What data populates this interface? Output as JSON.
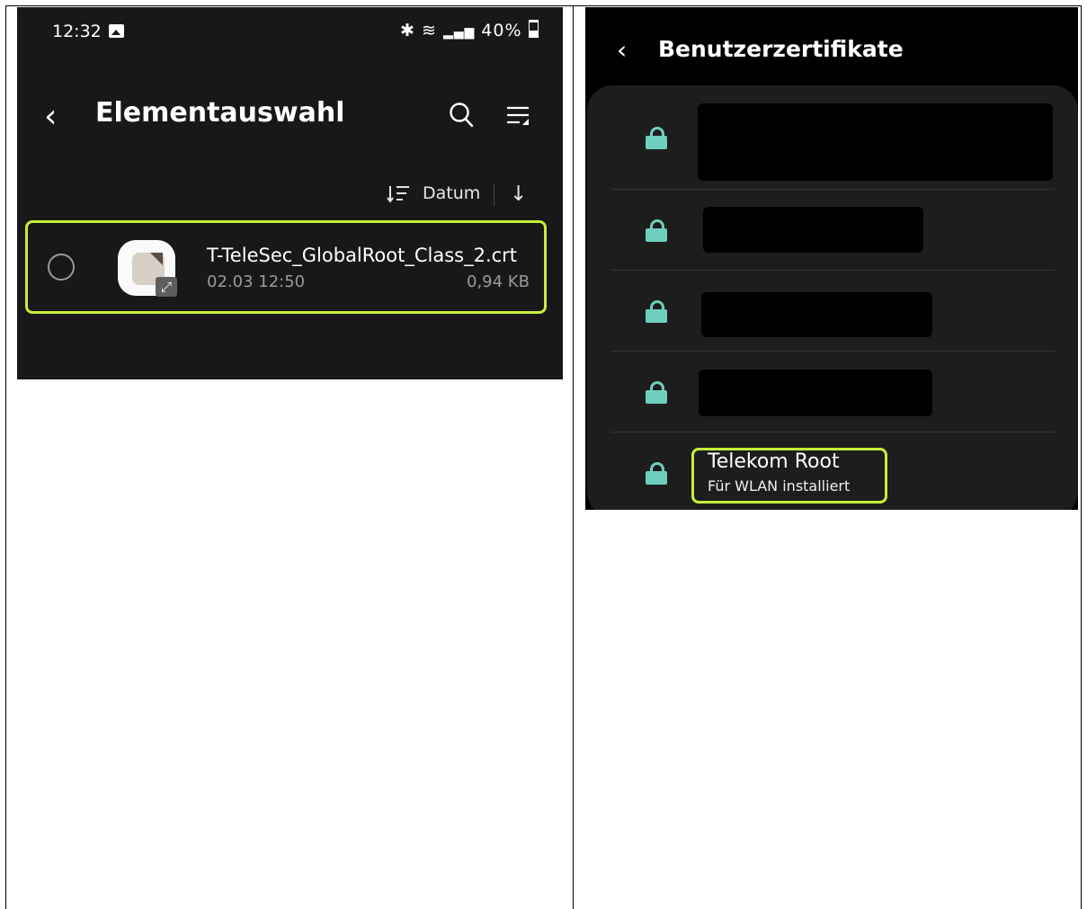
{
  "left_screen": {
    "status_bar": {
      "time": "12:32",
      "indicators": "40%",
      "icons": [
        "image-icon",
        "bluetooth-icon",
        "wifi-icon",
        "signal-icon",
        "battery-icon"
      ]
    },
    "header": {
      "back_icon": "chevron-left-icon",
      "title": "Elementauswahl",
      "actions": [
        "search-icon",
        "menu-icon"
      ]
    },
    "sort": {
      "icon": "sort-icon",
      "label": "Datum",
      "direction_icon": "arrow-down-icon"
    },
    "files": [
      {
        "name": "T-TeleSec_GlobalRoot_Class_2.crt",
        "date": "02.03 12:50",
        "size": "0,94 KB",
        "selected": false,
        "highlighted": true
      }
    ],
    "accent": "#c6ee3a",
    "background": "#181818"
  },
  "right_screen": {
    "header": {
      "back_icon": "chevron-left-icon",
      "title": "Benutzerzertifikate"
    },
    "certificates": [
      {
        "name": "",
        "subtitle": "",
        "redacted": true
      },
      {
        "name": "",
        "subtitle": "",
        "redacted": true
      },
      {
        "name": "",
        "subtitle": "",
        "redacted": true
      },
      {
        "name": "",
        "subtitle": "",
        "redacted": true
      },
      {
        "name": "Telekom Root",
        "subtitle": "Für WLAN installiert",
        "redacted": false,
        "highlighted": true
      }
    ],
    "lock_color": "#6fcfbe",
    "card_background": "#1d1d1d"
  }
}
